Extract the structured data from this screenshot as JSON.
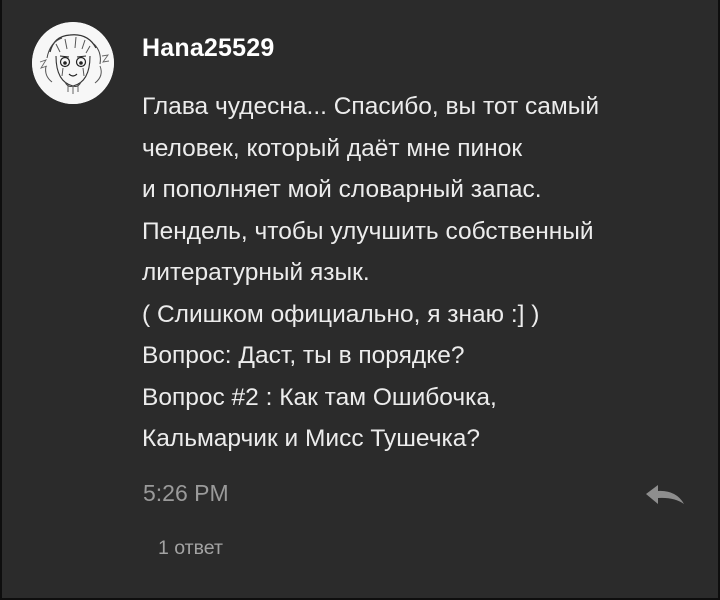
{
  "comment": {
    "author": "Hana25529",
    "lines": [
      "Глава чудесна... Спасибо, вы тот самый",
      "человек, который даёт мне пинок",
      "и пополняет мой словарный запас.",
      "Пендель, чтобы улучшить собственный",
      "литературный язык.",
      "( Слишком официально, я знаю :] )",
      "Вопрос: Даст, ты в порядке?",
      "Вопрос #2 : Как там Ошибочка,",
      "Кальмарчик и Мисс Тушечка?"
    ],
    "time": "5:26 PM",
    "replies": "1 ответ",
    "reply_icon": "reply-arrow-icon",
    "avatar_icon": "sketch-face-avatar"
  },
  "colors": {
    "background": "#2b2b2b",
    "username": "#ffffff",
    "text": "#ececec",
    "meta": "#9a9a9a"
  }
}
